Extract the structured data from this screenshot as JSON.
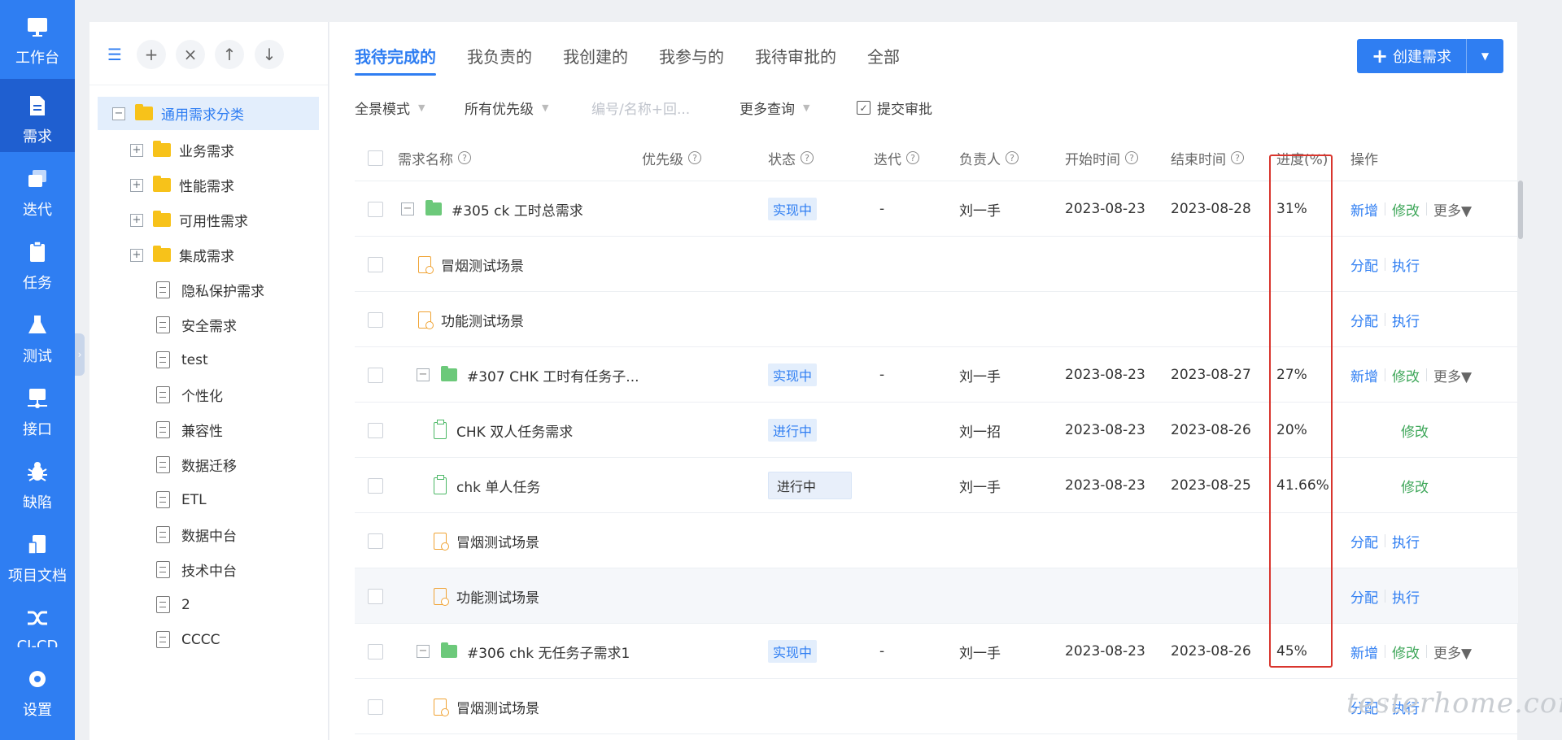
{
  "nav": {
    "items": [
      {
        "label": "工作台",
        "icon": "monitor-icon",
        "active": false
      },
      {
        "label": "需求",
        "icon": "document-icon",
        "active": true
      },
      {
        "label": "迭代",
        "icon": "layers-icon",
        "active": false
      },
      {
        "label": "任务",
        "icon": "clipboard-icon",
        "active": false
      },
      {
        "label": "测试",
        "icon": "flask-icon",
        "active": false
      },
      {
        "label": "接口",
        "icon": "network-icon",
        "active": false
      },
      {
        "label": "缺陷",
        "icon": "bug-icon",
        "active": false
      },
      {
        "label": "项目文档",
        "icon": "docs-icon",
        "active": false
      },
      {
        "label": "CI-CD",
        "icon": "shuffle-icon",
        "active": false
      },
      {
        "label": "设置",
        "icon": "gear-icon",
        "active": false
      }
    ],
    "collapse_glyph": "›"
  },
  "tree": {
    "toolbar": {
      "list": "☰",
      "add": "+",
      "close": "×",
      "up": "↑",
      "down": "↓"
    },
    "root": {
      "label": "通用需求分类",
      "expander": "−"
    },
    "folders": [
      {
        "label": "业务需求",
        "expander": "+"
      },
      {
        "label": "性能需求",
        "expander": "+"
      },
      {
        "label": "可用性需求",
        "expander": "+"
      },
      {
        "label": "集成需求",
        "expander": "+"
      }
    ],
    "docs": [
      "隐私保护需求",
      "安全需求",
      "test",
      "个性化",
      "兼容性",
      "数据迁移",
      "ETL",
      "数据中台",
      "技术中台",
      "2",
      "CCCC"
    ]
  },
  "tabs": [
    "我待完成的",
    "我负责的",
    "我创建的",
    "我参与的",
    "我待审批的",
    "全部"
  ],
  "create_button": {
    "label": "创建需求",
    "plus": "+",
    "caret": "▼"
  },
  "filters": {
    "view_mode": "全景模式",
    "priority": "所有优先级",
    "search_placeholder": "编号/名称+回...",
    "more_query": "更多查询",
    "submit_approval": "提交审批",
    "caret": "▼",
    "check": "✓"
  },
  "table": {
    "headers": {
      "name": "需求名称",
      "priority": "优先级",
      "status": "状态",
      "iteration": "迭代",
      "owner": "负责人",
      "start": "开始时间",
      "end": "结束时间",
      "progress": "进度(%)",
      "ops": "操作",
      "help": "?"
    },
    "rows": [
      {
        "type": "requirement",
        "expander": "−",
        "name": "#305 ck 工时总需求",
        "status": "实现中",
        "iteration": "-",
        "owner": "刘一手",
        "start": "2023-08-23",
        "end": "2023-08-28",
        "progress": "31%",
        "op1": "新增",
        "op2": "修改",
        "op3": "更多▼"
      },
      {
        "type": "scene",
        "name": "冒烟测试场景",
        "op1": "分配",
        "op2": "执行"
      },
      {
        "type": "scene",
        "name": "功能测试场景",
        "op1": "分配",
        "op2": "执行"
      },
      {
        "type": "requirement",
        "expander": "−",
        "name": "#307 CHK 工时有任务子...",
        "status": "实现中",
        "iteration": "-",
        "owner": "刘一手",
        "start": "2023-08-23",
        "end": "2023-08-27",
        "progress": "27%",
        "op1": "新增",
        "op2": "修改",
        "op3": "更多▼"
      },
      {
        "type": "task",
        "name": "CHK 双人任务需求",
        "status": "进行中",
        "owner": "刘一招",
        "start": "2023-08-23",
        "end": "2023-08-26",
        "progress": "20%",
        "op2": "修改"
      },
      {
        "type": "task",
        "name": "chk 单人任务",
        "status": "进行中",
        "owner": "刘一手",
        "start": "2023-08-23",
        "end": "2023-08-25",
        "progress": "41.66%",
        "op2": "修改"
      },
      {
        "type": "scene",
        "name": "冒烟测试场景",
        "op1": "分配",
        "op2": "执行"
      },
      {
        "type": "scene",
        "name": "功能测试场景",
        "op1": "分配",
        "op2": "执行"
      },
      {
        "type": "requirement",
        "expander": "−",
        "name": "#306 chk 无任务子需求1",
        "status": "实现中",
        "iteration": "-",
        "owner": "刘一手",
        "start": "2023-08-23",
        "end": "2023-08-26",
        "progress": "45%",
        "op1": "新增",
        "op2": "修改",
        "op3": "更多▼"
      },
      {
        "type": "scene",
        "name": "冒烟测试场景",
        "op1": "分配",
        "op2": "执行"
      }
    ]
  },
  "watermark": "testerhome.com",
  "colors": {
    "primary": "#2f7ef2",
    "green": "#3fa75a",
    "highlight": "#d9362e",
    "folder": "#f7c21a"
  }
}
